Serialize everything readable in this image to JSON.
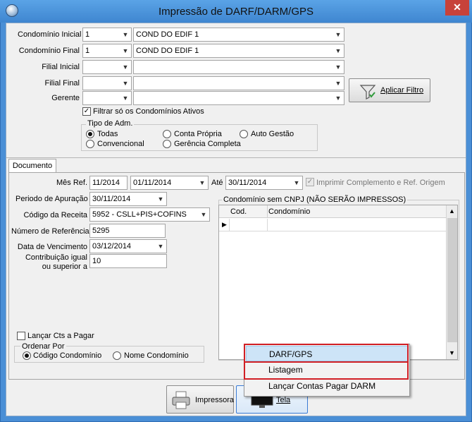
{
  "window": {
    "title": "Impressão de DARF/DARM/GPS",
    "close": "✕"
  },
  "filters": {
    "condominio_inicial": {
      "label": "Condomínio Inicial",
      "code": "1",
      "name": "COND DO EDIF 1"
    },
    "condominio_final": {
      "label": "Condomínio Final",
      "code": "1",
      "name": "COND DO EDIF 1"
    },
    "filial_inicial": {
      "label": "Filial Inicial",
      "code": "",
      "name": ""
    },
    "filial_final": {
      "label": "Filial Final",
      "code": "",
      "name": ""
    },
    "gerente": {
      "label": "Gerente",
      "code": "",
      "name": ""
    },
    "only_active": {
      "label": "Filtrar só os Condomínios Ativos",
      "checked": true
    },
    "apply_button": "Aplicar Filtro",
    "tipo_adm": {
      "legend": "Tipo de Adm.",
      "options": [
        "Todas",
        "Conta Própria",
        "Auto Gestão",
        "Convencional",
        "Gerência Completa"
      ],
      "selected": "Todas"
    }
  },
  "tabs": [
    "Documento"
  ],
  "documento": {
    "mes_ref": {
      "label": "Mês Ref.",
      "value": "11/2014",
      "from": "01/11/2014"
    },
    "ate": {
      "label": "Até",
      "value": "30/11/2014"
    },
    "imprimir_complemento": {
      "label": "Imprimir Complemento e Ref. Origem",
      "checked": true
    },
    "periodo_apuracao": {
      "label": "Periodo de Apuração",
      "value": "30/11/2014"
    },
    "codigo_receita": {
      "label": "Código da Receita",
      "value": "5952 - CSLL+PIS+COFINS"
    },
    "numero_referencia": {
      "label": "Número de Referência",
      "value": "5295"
    },
    "data_vencimento": {
      "label": "Data de Vencimento",
      "value": "03/12/2014"
    },
    "contribuicao": {
      "label1": "Contribuição igual",
      "label2": "ou superior a",
      "value": "10"
    },
    "lancar_cts": {
      "label": "Lançar Cts a Pagar",
      "checked": false
    },
    "ordenar_por": {
      "legend": "Ordenar Por",
      "options": [
        "Código Condomínio",
        "Nome Condomínio"
      ],
      "selected": "Código Condomínio"
    }
  },
  "grid": {
    "title": "Condomínio sem CNPJ (NÃO SERÃO IMPRESSOS)",
    "columns": [
      "Cod.",
      "Condomínio"
    ],
    "rows": []
  },
  "buttons": {
    "impressora": "Impressora",
    "tela": "Tela"
  },
  "menu": {
    "items": [
      "DARF/GPS",
      "Listagem",
      "Lançar Contas Pagar DARM"
    ],
    "highlighted": "DARF/GPS"
  },
  "colors": {
    "titlebar": "#4a8fd6",
    "highlight_box": "#d11f25",
    "menu_highlight": "#cde4f7"
  },
  "icons": [
    "app-icon",
    "filter-icon",
    "printer-icon",
    "monitor-icon",
    "chevron-down-icon",
    "check-icon"
  ]
}
